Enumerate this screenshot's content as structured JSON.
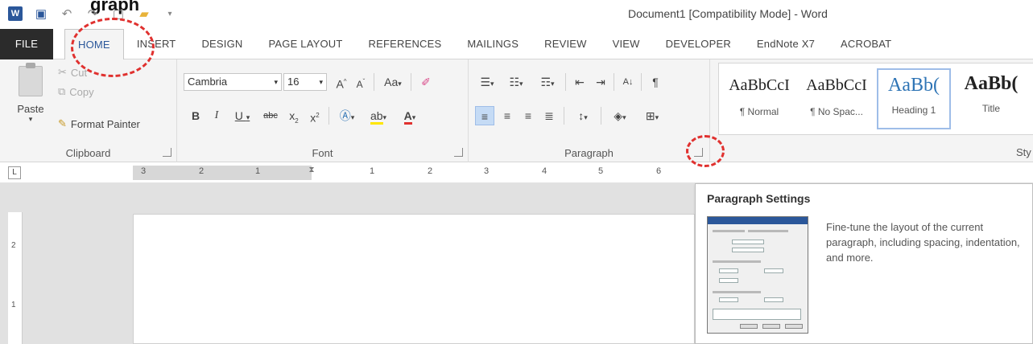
{
  "window": {
    "title": "Document1 [Compatibility Mode] - Word",
    "clipped_heading": "graph"
  },
  "quick_access": {
    "icons": [
      "word-icon",
      "save-icon",
      "undo-icon",
      "redo-icon",
      "new-document-icon",
      "open-folder-icon",
      "customize-qat-icon"
    ]
  },
  "tabs": [
    {
      "label": "FILE"
    },
    {
      "label": "HOME"
    },
    {
      "label": "INSERT"
    },
    {
      "label": "DESIGN"
    },
    {
      "label": "PAGE LAYOUT"
    },
    {
      "label": "REFERENCES"
    },
    {
      "label": "MAILINGS"
    },
    {
      "label": "REVIEW"
    },
    {
      "label": "VIEW"
    },
    {
      "label": "DEVELOPER"
    },
    {
      "label": "EndNote X7"
    },
    {
      "label": "ACROBAT"
    }
  ],
  "clipboard": {
    "group_label": "Clipboard",
    "paste": "Paste",
    "cut": "Cut",
    "copy": "Copy",
    "format_painter": "Format Painter"
  },
  "font": {
    "group_label": "Font",
    "font_name": "Cambria",
    "font_size": "16",
    "change_case": "Aa"
  },
  "paragraph": {
    "group_label": "Paragraph"
  },
  "styles": {
    "group_label": "Sty",
    "items": [
      {
        "sample": "AaBbCcI",
        "label": "¶ Normal"
      },
      {
        "sample": "AaBbCcI",
        "label": "¶ No Spac..."
      },
      {
        "sample": "AaBb(",
        "label": "Heading 1"
      },
      {
        "sample": "AaBb(",
        "label": "Title"
      }
    ]
  },
  "ruler": {
    "numbers": [
      "3",
      "2",
      "1",
      "1",
      "2",
      "3",
      "4",
      "5",
      "6"
    ],
    "corner": "L",
    "vertical_numbers": [
      "2",
      "1"
    ]
  },
  "tooltip": {
    "title": "Paragraph Settings",
    "description": "Fine-tune the layout of the current paragraph, including spacing, indentation, and more."
  },
  "colors": {
    "accent": "#2b579a",
    "annotation": "#e0312f",
    "file_tab": "#2b2b2b",
    "heading_style": "#2e74b5"
  }
}
